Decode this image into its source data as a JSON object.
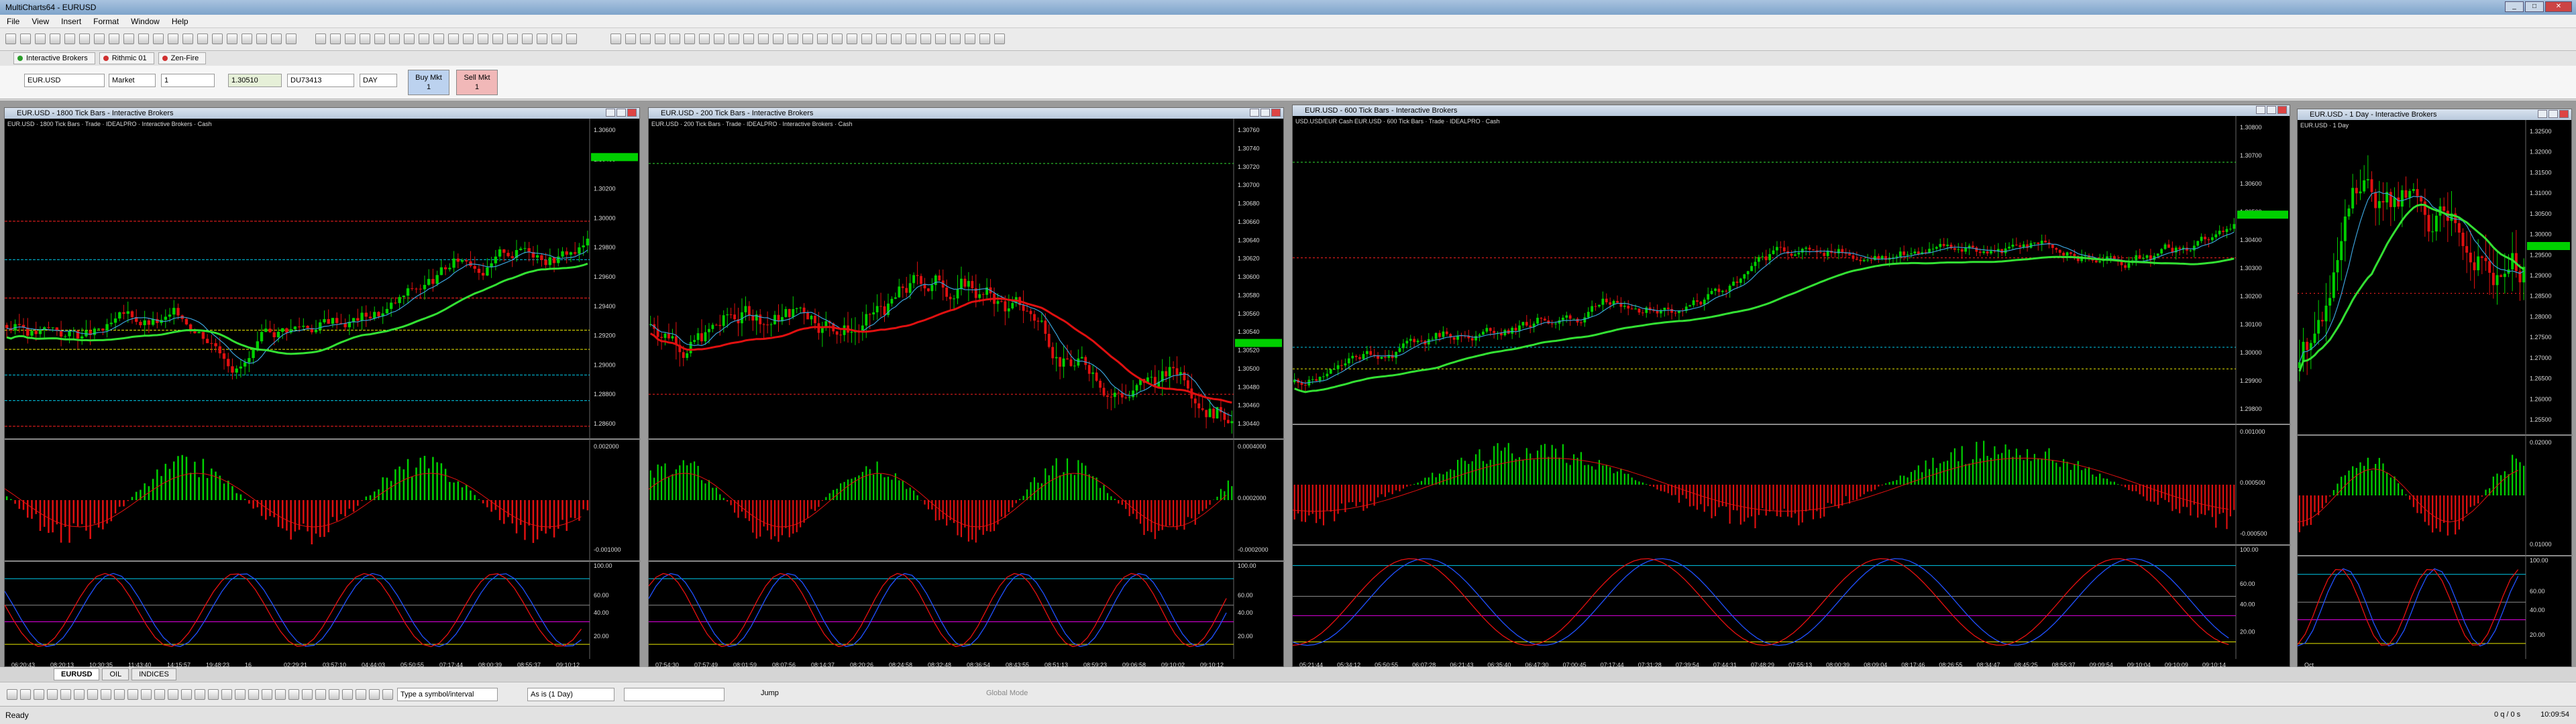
{
  "app": {
    "title": "MultiCharts64 - EURUSD"
  },
  "menu": [
    "File",
    "View",
    "Insert",
    "Format",
    "Window",
    "Help"
  ],
  "workspace_tabs": [
    {
      "label": "Interactive Brokers",
      "color": "#2a9d2a"
    },
    {
      "label": "Rithmic 01",
      "color": "#d03030"
    },
    {
      "label": "Zen-Fire",
      "color": "#d03030"
    }
  ],
  "order_bar": {
    "symbol": "EUR.USD",
    "order_type": "Market",
    "quantity": "1",
    "price": "1.30510",
    "account": "DU73413",
    "tif": "DAY",
    "buy_label": "Buy Mkt",
    "buy_qty": "1",
    "sell_label": "Sell Mkt",
    "sell_qty": "1"
  },
  "charts": [
    {
      "window_title": "EUR.USD - 1800 Tick Bars - Interactive Brokers",
      "legend": "EUR.USD · 1800 Tick Bars · Trade · IDEALPRO · Interactive Brokers · Cash",
      "price_ticks": [
        "1.30600",
        "1.30400",
        "1.30200",
        "1.30000",
        "1.29800",
        "1.29600",
        "1.29400",
        "1.29200",
        "1.29000",
        "1.28800",
        "1.28600"
      ],
      "osc_ticks": [
        "0.002000",
        "-0.001000"
      ],
      "stoch_ticks": [
        "100.00",
        "60.00",
        "40.00",
        "20.00"
      ],
      "time_ticks": [
        "06:20:43",
        "08:20:13",
        "10:30:35",
        "11:43:40",
        "14:15:57",
        "19:48:23",
        "16",
        "02:29:21",
        "03:57:10",
        "04:44:03",
        "05:50:55",
        "07:17:44",
        "08:00:39",
        "08:55:37",
        "09:10:12"
      ]
    },
    {
      "window_title": "EUR.USD - 200 Tick Bars - Interactive Brokers",
      "legend": "EUR.USD · 200 Tick Bars · Trade · IDEALPRO · Interactive Brokers · Cash",
      "price_ticks": [
        "1.30760",
        "1.30740",
        "1.30720",
        "1.30700",
        "1.30680",
        "1.30660",
        "1.30640",
        "1.30620",
        "1.30600",
        "1.30580",
        "1.30560",
        "1.30540",
        "1.30520",
        "1.30500",
        "1.30480",
        "1.30460",
        "1.30440"
      ],
      "osc_ticks": [
        "0.0004000",
        "0.0002000",
        "-0.0002000"
      ],
      "stoch_ticks": [
        "100.00",
        "60.00",
        "40.00",
        "20.00"
      ],
      "time_ticks": [
        "07:54:30",
        "07:57:49",
        "08:01:59",
        "08:07:56",
        "08:14:37",
        "08:20:26",
        "08:24:58",
        "08:32:48",
        "08:36:54",
        "08:43:55",
        "08:51:13",
        "08:59:23",
        "09:06:58",
        "09:10:02",
        "09:10:12"
      ]
    },
    {
      "window_title": "EUR.USD - 600 Tick Bars - Interactive Brokers",
      "legend": "USD.USD/EUR Cash EUR.USD · 600 Tick Bars · Trade · IDEALPRO · Cash",
      "price_ticks": [
        "1.30800",
        "1.30700",
        "1.30600",
        "1.30500",
        "1.30400",
        "1.30300",
        "1.30200",
        "1.30100",
        "1.30000",
        "1.29900",
        "1.29800"
      ],
      "osc_ticks": [
        "0.001000",
        "0.000500",
        "-0.000500"
      ],
      "stoch_ticks": [
        "100.00",
        "60.00",
        "40.00",
        "20.00"
      ],
      "time_ticks": [
        "05:21:44",
        "05:34:12",
        "05:50:55",
        "06:07:28",
        "06:21:43",
        "06:35:40",
        "06:47:30",
        "07:00:45",
        "07:17:44",
        "07:31:28",
        "07:39:54",
        "07:44:31",
        "07:48:29",
        "07:55:13",
        "08:00:39",
        "08:09:04",
        "08:17:46",
        "08:26:55",
        "08:34:47",
        "08:45:25",
        "08:55:37",
        "09:09:54",
        "09:10:04",
        "09:10:09",
        "09:10:14"
      ]
    },
    {
      "window_title": "EUR.USD - 1 Day - Interactive Brokers",
      "legend": "EUR.USD · 1 Day",
      "price_ticks": [
        "1.32500",
        "1.32000",
        "1.31500",
        "1.31000",
        "1.30500",
        "1.30000",
        "1.29500",
        "1.29000",
        "1.28500",
        "1.28000",
        "1.27500",
        "1.27000",
        "1.26500",
        "1.26000",
        "1.25500"
      ],
      "osc_ticks": [
        "0.02000",
        "0.01000"
      ],
      "stoch_ticks": [
        "100.00",
        "60.00",
        "40.00",
        "20.00"
      ],
      "time_ticks": [
        "Oct"
      ]
    }
  ],
  "sheet_tabs": [
    "EURUSD",
    "OIL",
    "INDICES"
  ],
  "drawing_toolbar": {
    "symbol_placeholder": "Type a symbol/interval",
    "resolution": "As is (1 Day)",
    "jump_label": "Jump",
    "global_mode_label": "Global Mode"
  },
  "status": {
    "ready": "Ready",
    "ticks": "0 q / 0 s",
    "time": "10:09:54"
  },
  "colors": {
    "up": "#00d000",
    "down": "#e01010",
    "ema_fast": "#3aa0d8",
    "ema_slow": "#33e033",
    "level_red": "#ff2020",
    "level_yellow": "#e8e800",
    "level_cyan": "#00c8e8",
    "stoch_k": "#e81010",
    "stoch_d": "#2050ff"
  }
}
